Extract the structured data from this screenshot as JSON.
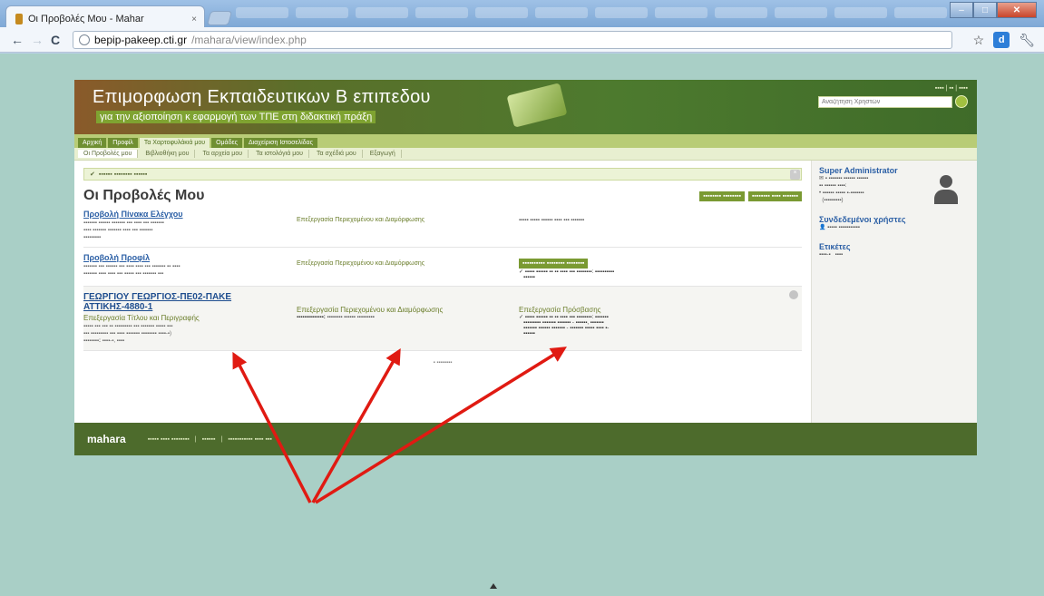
{
  "browser": {
    "tab_title": "Οι Προβολές Μου - Mahar",
    "tab_close": "×",
    "url_host": "bepip-pakeep.cti.gr",
    "url_path": "/mahara/view/index.php",
    "window_controls": [
      "–",
      "□",
      "✕"
    ],
    "toolbar_icons": [
      "star-icon",
      "extension-icon",
      "wrench-icon"
    ],
    "extension_letter": "d"
  },
  "banner": {
    "title": "Επιμορφωση Εκπαιδευτικων  Β επιπεδου",
    "subtitle": "για την αξιοποίηση κ εφαρμογή των ΤΠΕ στη διδακτική πράξη",
    "search_placeholder": "Αναζήτηση Χρηστών"
  },
  "main_nav": [
    "Αρχική",
    "Προφίλ",
    "Τα Χαρτοφυλάκιά μου",
    "Ομάδες",
    "Διαχείριση Ιστοσελίδας"
  ],
  "main_nav_active": 2,
  "sub_nav": [
    "Οι Προβολές μου",
    "Βιβλιοθήκη μου",
    "Τα αρχεία μου",
    "Τα ιστολόγιά μου",
    "Τα σχέδιά μου",
    "Εξαγωγή"
  ],
  "sub_nav_active": 0,
  "page_title": "Οι Προβολές Μου",
  "views": [
    {
      "title": "Προβολή Πίνακα Ελέγχου",
      "access": "Επεξεργασία Περιεχομένου και Διαμόρφωσης"
    },
    {
      "title": "Προβολή Προφίλ",
      "access": "Επεξεργασία Περιεχομένου και Διαμόρφωσης"
    },
    {
      "title": "ΓΕΩΡΓΙΟΥ ΓΕΩΡΓΙΟΣ-ΠΕ02-ΠΑΚΕ ΑΤΤΙΚΗΣ-4880-1",
      "col1": "Επεξεργασία Τίτλου και Περιγραφής",
      "col2": "Επεξεργασία Περιεχομένου και Διαμόρφωσης",
      "col3": "Επεξεργασία Πρόσβασης"
    }
  ],
  "sidebar": {
    "user_name": "Super Administrator",
    "online_title": "Συνδεδεμένοι χρήστες",
    "tags_title": "Ετικέτες"
  },
  "footer": {
    "logo": "mahara"
  }
}
